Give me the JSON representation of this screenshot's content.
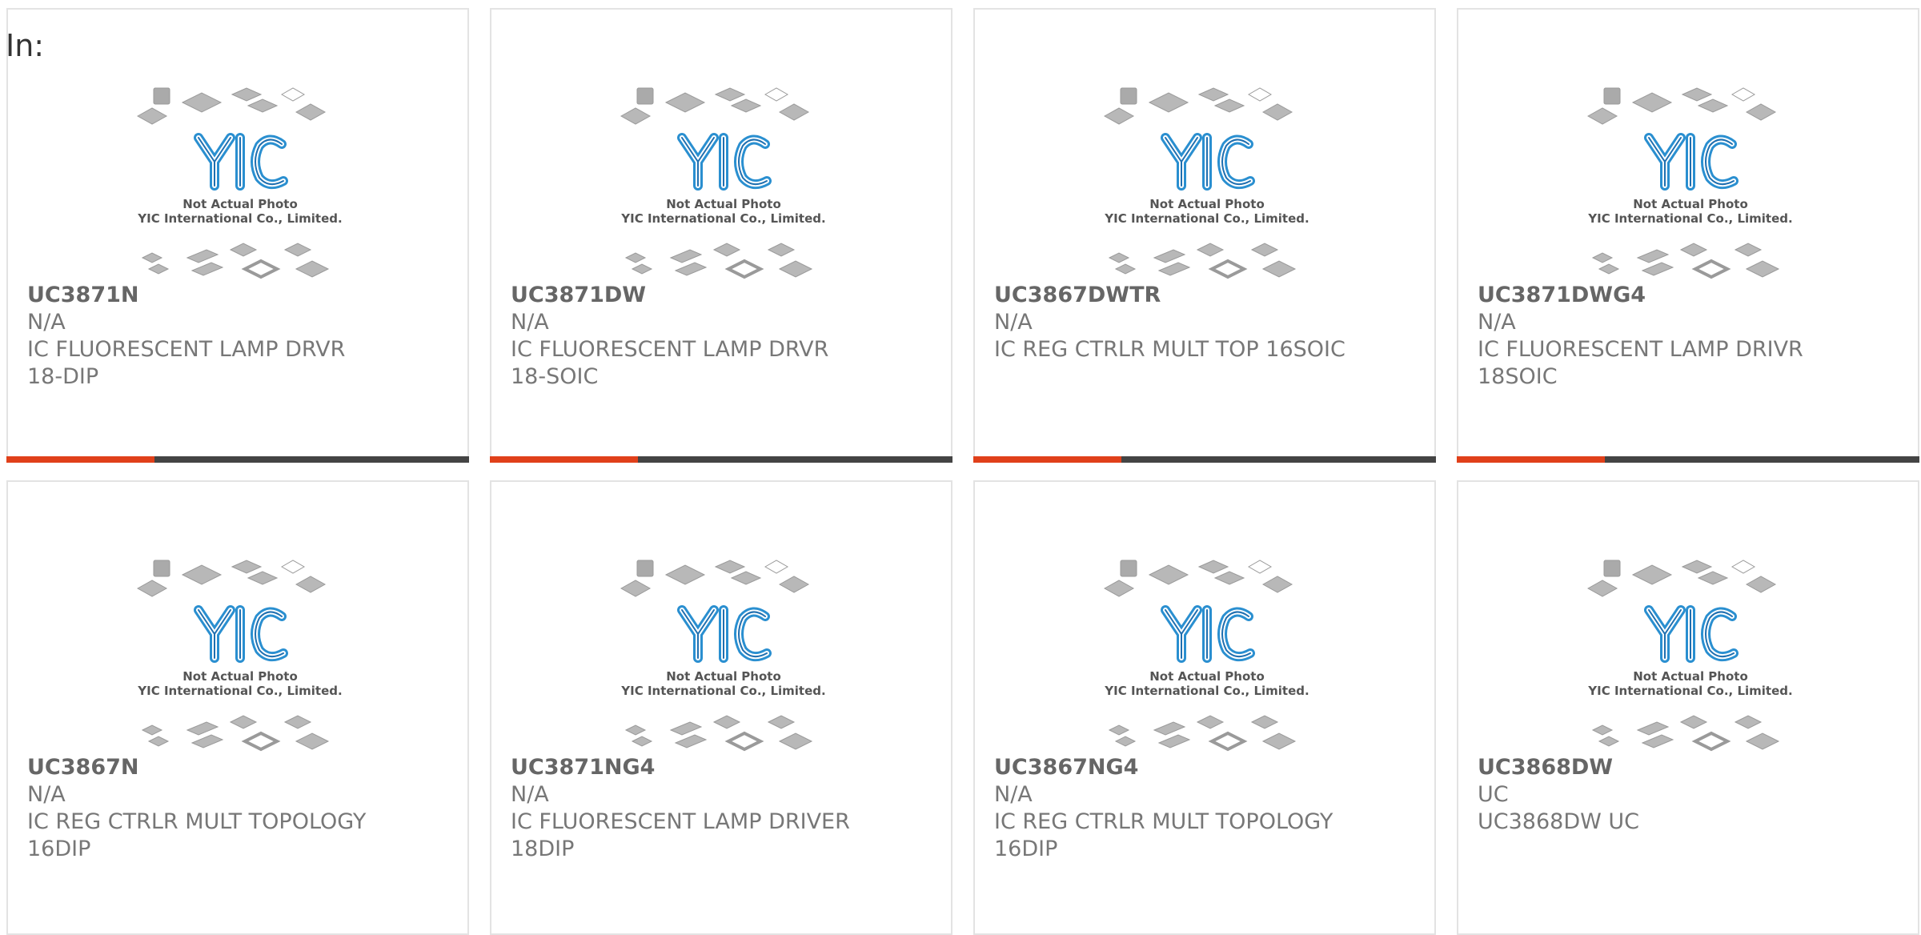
{
  "page": {
    "label": "In:"
  },
  "brand": {
    "logo_text": "YIC",
    "caption_line1": "Not Actual Photo",
    "caption_line2": "YIC International Co., Limited."
  },
  "colors": {
    "accent": "#e0401a",
    "bar_track": "#444444",
    "logo_blue": "#2a8fd0",
    "border": "#e3e3e3"
  },
  "products": [
    {
      "part": "UC3871N",
      "manufacturer": "N/A",
      "description": "IC FLUORESCENT LAMP DRVR\n18-DIP",
      "progress_fraction": 0.32
    },
    {
      "part": "UC3871DW",
      "manufacturer": "N/A",
      "description": "IC FLUORESCENT LAMP DRVR\n18-SOIC",
      "progress_fraction": 0.32
    },
    {
      "part": "UC3867DWTR",
      "manufacturer": "N/A",
      "description": "IC REG CTRLR MULT TOP 16SOIC",
      "progress_fraction": 0.32
    },
    {
      "part": "UC3871DWG4",
      "manufacturer": "N/A",
      "description": "IC FLUORESCENT LAMP DRIVR\n18SOIC",
      "progress_fraction": 0.32
    },
    {
      "part": "UC3867N",
      "manufacturer": "N/A",
      "description": "IC REG CTRLR MULT TOPOLOGY\n16DIP",
      "progress_fraction": null
    },
    {
      "part": "UC3871NG4",
      "manufacturer": "N/A",
      "description": "IC FLUORESCENT LAMP DRIVER\n18DIP",
      "progress_fraction": null
    },
    {
      "part": "UC3867NG4",
      "manufacturer": "N/A",
      "description": "IC REG CTRLR MULT TOPOLOGY\n16DIP",
      "progress_fraction": null
    },
    {
      "part": "UC3868DW",
      "manufacturer": "UC",
      "description": "UC3868DW UC",
      "progress_fraction": null
    }
  ]
}
